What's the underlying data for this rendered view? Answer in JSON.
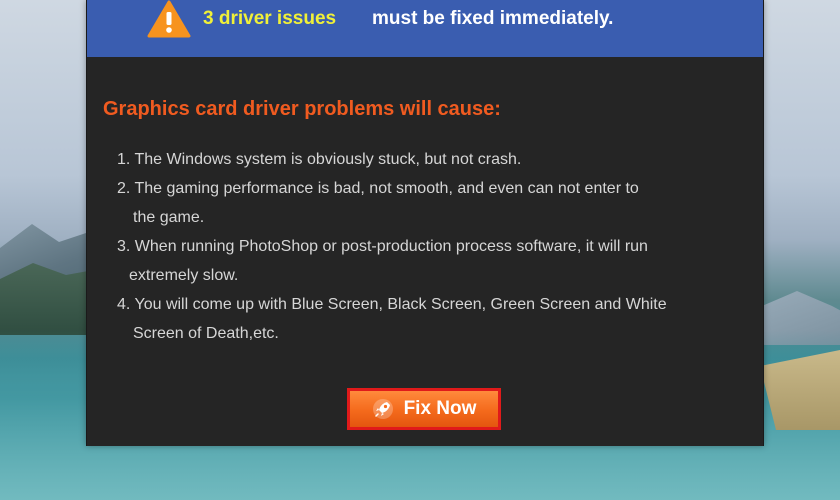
{
  "header": {
    "icon": "warning-icon",
    "issues_text": "3 driver issues",
    "must_text": "must be fixed immediately.",
    "background_color": "#3a5db0",
    "issues_color": "#f0f038"
  },
  "content": {
    "title": "Graphics card driver problems will cause:",
    "title_color": "#f05b20",
    "items": [
      {
        "line1": "1. The Windows system is obviously stuck, but not crash.",
        "line2": ""
      },
      {
        "line1": "2. The gaming performance is bad, not smooth, and even can not enter to",
        "line2": "the game."
      },
      {
        "line1": "3. When running PhotoShop or post-production process software, it will run",
        "line2": "extremely slow."
      },
      {
        "line1": "4. You will come up with Blue Screen, Black Screen, Green Screen and White",
        "line2": "Screen of Death,etc."
      }
    ]
  },
  "action": {
    "fix_label": "Fix Now",
    "icon": "rocket-icon",
    "button_color": "#f46a1c",
    "border_color": "#e01a1a"
  }
}
